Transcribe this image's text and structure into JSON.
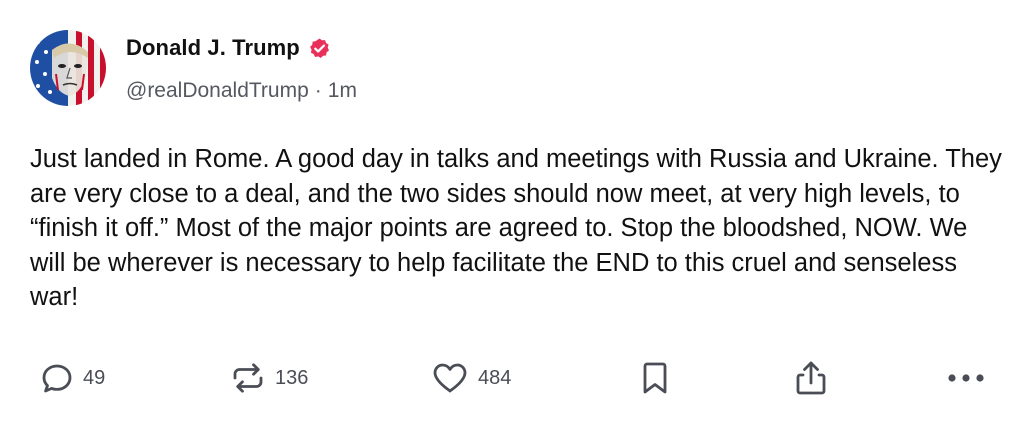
{
  "author": {
    "display_name": "Donald J. Trump",
    "handle": "@realDonaldTrump",
    "separator": "·",
    "time_ago": "1m",
    "verified": true,
    "verified_badge_color": "#e8305a"
  },
  "post": {
    "text": "Just landed in Rome. A good day in talks and meetings with Russia and Ukraine. They are very close to a deal, and the two sides should now meet, at very high levels, to “finish it off.” Most of the major points are agreed to. Stop the bloodshed, NOW. We will be wherever is necessary to help facilitate the END to this cruel and senseless war!"
  },
  "actions": {
    "replies": "49",
    "reposts": "136",
    "likes": "484",
    "icons": [
      "reply-icon",
      "repost-icon",
      "like-icon",
      "bookmark-icon",
      "share-icon",
      "more-icon"
    ]
  },
  "colors": {
    "text": "#111111",
    "secondary_text": "#555860",
    "icon": "#4a4d55",
    "avatar_flag_red": "#c8102e",
    "avatar_flag_blue": "#1f4fa3"
  }
}
